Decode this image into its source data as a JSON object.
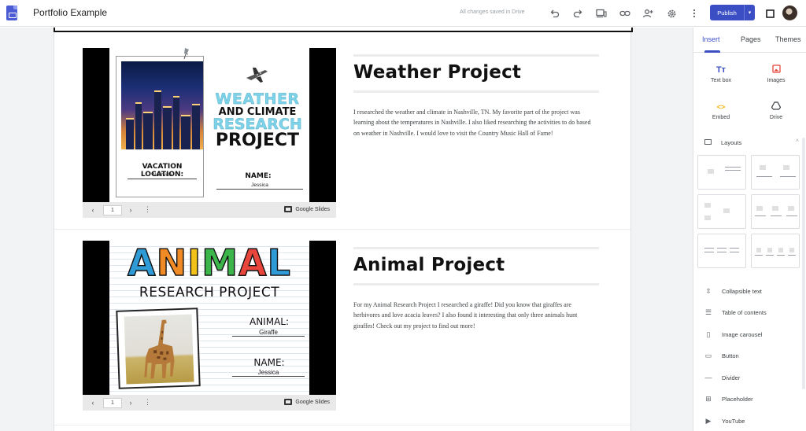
{
  "topbar": {
    "title": "Portfolio Example",
    "saved_status": "All changes saved in Drive",
    "publish_label": "Publish",
    "icons": [
      "undo-icon",
      "redo-icon",
      "preview-icon",
      "link-icon",
      "share-icon",
      "settings-icon",
      "more-icon"
    ]
  },
  "sections": [
    {
      "title": "Weather Project",
      "description": "I researched the weather and climate in Nashville, TN. My favorite part of the project was learning about the temperatures in Nashville. I also liked researching the activities to do based on weather in Nashville. I would love to visit the Country Music Hall of Fame!",
      "embed": {
        "page_number": "1",
        "source_label": "Google Slides",
        "slide": {
          "title_line1": "WEATHER",
          "title_line2": "AND CLIMATE",
          "title_line3": "RESEARCH",
          "title_line4": "PROJECT",
          "location_label": "VACATION LOCATION:",
          "location_value": "Nashville",
          "name_label": "NAME:",
          "name_value": "Jessica"
        }
      }
    },
    {
      "title": "Animal Project",
      "description": "For my Animal Research Project I researched a giraffe! Did you know that giraffes are herbivores and love acacia leaves? I also found it interesting that only three animals hunt giraffes! Check out my project to find out more!",
      "embed": {
        "page_number": "1",
        "source_label": "Google Slides",
        "slide": {
          "title": "ANIMAL",
          "title_colors": [
            "#2f9bd6",
            "#f08a24",
            "#f2c21b",
            "#3cb54a",
            "#e8453c",
            "#2f9bd6"
          ],
          "subtitle": "RESEARCH PROJECT",
          "animal_label": "ANIMAL:",
          "animal_value": "Giraffe",
          "name_label": "NAME:",
          "name_value": "Jessica"
        }
      }
    }
  ],
  "panel": {
    "tabs": [
      "Insert",
      "Pages",
      "Themes"
    ],
    "active_tab": "Insert",
    "insert_items": [
      {
        "label": "Text box",
        "icon": "text-box-icon"
      },
      {
        "label": "Images",
        "icon": "images-icon"
      },
      {
        "label": "Embed",
        "icon": "embed-icon"
      },
      {
        "label": "Drive",
        "icon": "drive-icon"
      }
    ],
    "layouts_label": "Layouts",
    "components": [
      {
        "label": "Collapsible text",
        "icon": "collapsible-text-icon"
      },
      {
        "label": "Table of contents",
        "icon": "table-of-contents-icon"
      },
      {
        "label": "Image carousel",
        "icon": "image-carousel-icon"
      },
      {
        "label": "Button",
        "icon": "button-icon"
      },
      {
        "label": "Divider",
        "icon": "divider-icon"
      },
      {
        "label": "Placeholder",
        "icon": "placeholder-icon"
      },
      {
        "label": "YouTube",
        "icon": "youtube-icon"
      }
    ]
  },
  "colors": {
    "accent": "#3c4ec4",
    "images_icon": "#e8453c",
    "embed_icon": "#f4b400"
  }
}
